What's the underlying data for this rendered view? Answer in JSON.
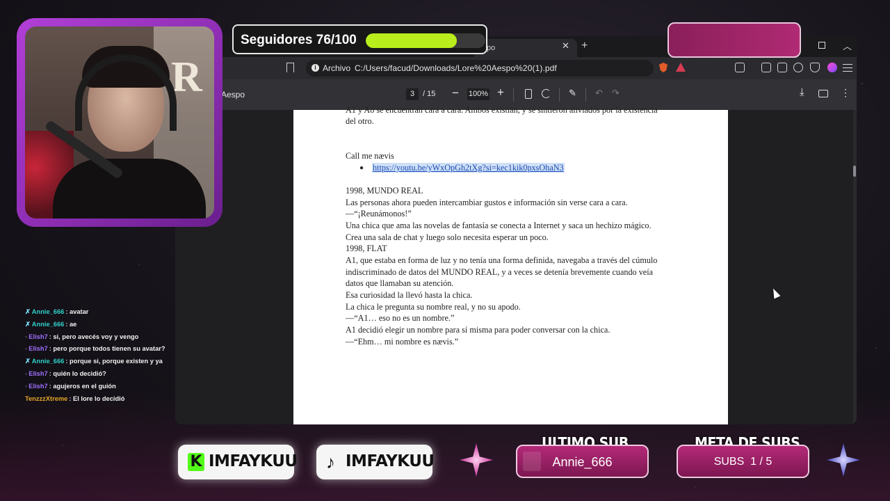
{
  "browser": {
    "tab_title": "po",
    "address_scheme": "Archivo",
    "address_url": "C:/Users/facud/Downloads/Lore%20Aespo%20(1).pdf"
  },
  "pdf_toolbar": {
    "doc_title": "Aespo",
    "current_page": "3",
    "total_pages": "/ 15",
    "zoom": "100%"
  },
  "pdf_content": {
    "line_partial_1": "A1 y Ao se encuentran cara a cara. Ambos existían, y se sintieron aliviados por la existencia",
    "line_partial_2": "del otro.",
    "song_title": "Call me nævis",
    "song_link": "https://youtu.be/yWxOpGh2tXg?si=kec1kik0pxsOhaN3",
    "paragraphs": [
      "1998, MUNDO REAL",
      "Las personas ahora pueden intercambiar gustos e información sin verse cara a cara.",
      "—“¡Reunámonos!”",
      "Una chica que ama las novelas de fantasía se conecta a Internet y saca un hechizo mágico.",
      "Crea una sala de chat y luego solo necesita esperar un poco.",
      "1998, FLAT",
      "A1, que estaba en forma de luz y no tenía una forma definida, navegaba a través del cúmulo",
      "indiscriminado de datos del MUNDO REAL, y a veces se detenía brevemente cuando veía",
      "datos que llamaban su atención.",
      "Esa curiosidad la llevó hasta la chica.",
      "La chica le pregunta su nombre real, y no su apodo.",
      "—“A1… eso no es un nombre.”",
      "A1 decidió elegir un nombre para sí misma para poder conversar con la chica.",
      "—“Ehm… mi nombre es nævis.”"
    ]
  },
  "webcam": {
    "bg_letter": "R"
  },
  "followers": {
    "label": "Seguidores 76/100",
    "current": 76,
    "goal": 100,
    "fill_color": "#b9ee1c"
  },
  "chat": [
    {
      "badge": "✗",
      "user": "Annie_666",
      "user_color": "#2fd0c8",
      "message": "avatar"
    },
    {
      "badge": "✗",
      "user": "Annie_666",
      "user_color": "#2fd0c8",
      "message": "ae"
    },
    {
      "badge": "◦",
      "user": "Elish7",
      "user_color": "#a071ff",
      "message": "si, pero avecés voy y vengo"
    },
    {
      "badge": "◦",
      "user": "Elish7",
      "user_color": "#a071ff",
      "message": "pero porque todos tienen su avatar?"
    },
    {
      "badge": "✗",
      "user": "Annie_666",
      "user_color": "#2fd0c8",
      "message": "porque si, porque existen y ya"
    },
    {
      "badge": "◦",
      "user": "Elish7",
      "user_color": "#a071ff",
      "message": "quién lo decidió?"
    },
    {
      "badge": "◦",
      "user": "Elish7",
      "user_color": "#a071ff",
      "message": "agujeros en el guión"
    },
    {
      "badge": "",
      "user": "TenzzzXtreme",
      "user_color": "#e6a72a",
      "message": "El lore lo decidió"
    }
  ],
  "socials": {
    "kick_handle": "IMFAYKUU",
    "tiktok_handle": "IMFAYKUU"
  },
  "last_sub": {
    "title": "ULTIMO SUB",
    "name": "Annie_666"
  },
  "sub_goal": {
    "title": "META DE SUBS",
    "text": "SUBS  1 / 5",
    "current": 1,
    "goal": 5
  },
  "colors": {
    "accent_pink": "#b42a78",
    "cam_border": "#b13fd6",
    "link": "#1a4bb8"
  }
}
